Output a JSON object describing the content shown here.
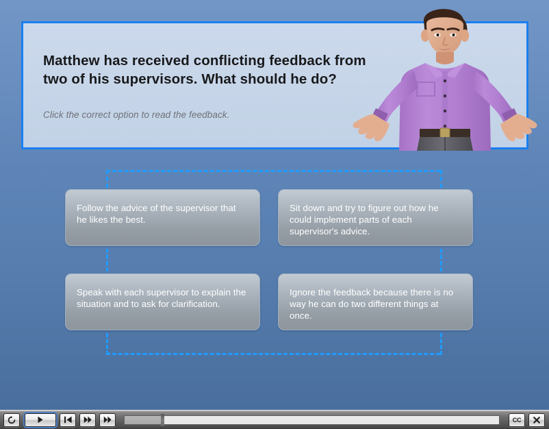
{
  "slide": {
    "headline": "Matthew has received conflicting feedback from\ntwo of his supervisors. What should he do?",
    "instruction": "Click the correct option to read the feedback.",
    "person_alt": "man-shrugging-photo",
    "colors": {
      "panel_border": "#1a7ff0",
      "panel_fill": "#c9d7ea",
      "background_top": "#7296c6",
      "background_bottom": "#4a6f9e",
      "dashed_connector": "#1f9cff",
      "option_text": "#ffffff",
      "shirt": "#b47fd0",
      "trousers": "#5e5e63"
    },
    "options": [
      {
        "id": "option-1",
        "text": "Follow the advice of the supervisor that he likes the best."
      },
      {
        "id": "option-2",
        "text": "Sit down and try to figure out how he could implement parts of each supervisor's advice."
      },
      {
        "id": "option-3",
        "text": "Speak with each supervisor to explain the situation and to ask for clarification."
      },
      {
        "id": "option-4",
        "text": "Ignore the feedback because there is no way he can do two different things at once."
      }
    ]
  },
  "player": {
    "buttons": {
      "replay": "replay-icon",
      "play": "play-icon",
      "previous": "previous-slide-icon",
      "next": "next-slide-icon",
      "forward": "fast-forward-icon",
      "captions": "CC",
      "close": "close-icon"
    },
    "seek": {
      "progress_percent": 10
    }
  }
}
